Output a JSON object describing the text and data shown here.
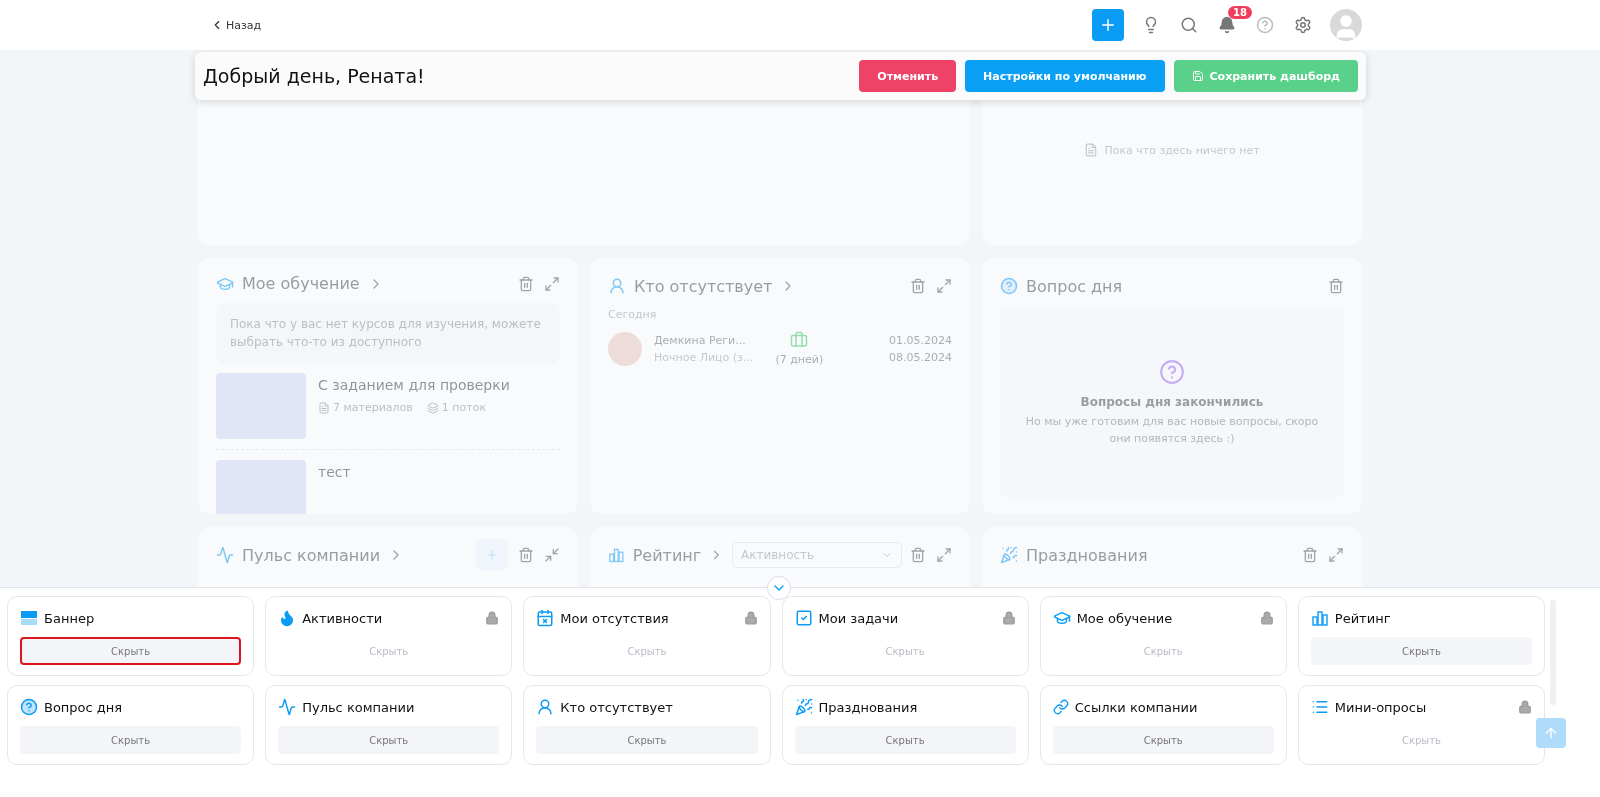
{
  "header": {
    "back": "Назад",
    "notifications": "18"
  },
  "edit_bar": {
    "greeting": "Добрый день, Рената!",
    "buttons": [
      {
        "label": "Отменить",
        "kind": "danger"
      },
      {
        "label": "Настройки по умолчанию",
        "kind": "primary"
      },
      {
        "label": "Сохранить дашборд",
        "kind": "success"
      }
    ]
  },
  "tasks": {
    "empty": "Пока что здесь ничего нет"
  },
  "learning": {
    "title": "Мое обучение",
    "notice": "Пока что у вас нет курсов для изучения, можете выбрать что-то из доступного",
    "courses": [
      {
        "title": "С заданием для проверки",
        "materials": "7 материалов",
        "streams": "1 поток"
      },
      {
        "title": "тест"
      }
    ]
  },
  "absent": {
    "title": "Кто отсутствует",
    "section": "Сегодня",
    "people": [
      {
        "name": "Демкина Реги...",
        "role": "Ночное Лицо (з...",
        "duration": "(7 дней)",
        "from": "01.05.2024",
        "to": "08.05.2024"
      }
    ]
  },
  "question": {
    "title": "Вопрос дня",
    "heading": "Вопросы дня закончились",
    "text": "Но мы уже готовим для вас новые вопросы, скоро они появятся здесь :)"
  },
  "pulse": {
    "title": "Пульс компании"
  },
  "rating": {
    "title": "Рейтинг",
    "filter": "Активность"
  },
  "celebrations": {
    "title": "Празднования"
  },
  "palette": [
    {
      "title": "Баннер",
      "kind": "banner",
      "locked": false,
      "selected": true,
      "action": "Скрыть"
    },
    {
      "title": "Активности",
      "kind": "fire",
      "locked": true,
      "selected": false,
      "action": "Скрыть"
    },
    {
      "title": "Мои отсутствия",
      "kind": "calendar",
      "locked": true,
      "selected": false,
      "action": "Скрыть"
    },
    {
      "title": "Мои задачи",
      "kind": "check",
      "locked": true,
      "selected": false,
      "action": "Скрыть"
    },
    {
      "title": "Мое обучение",
      "kind": "cap",
      "locked": true,
      "selected": false,
      "action": "Скрыть"
    },
    {
      "title": "Рейтинг",
      "kind": "chart",
      "locked": false,
      "selected": false,
      "action": "Скрыть"
    },
    {
      "title": "Вопрос дня",
      "kind": "question",
      "locked": false,
      "selected": false,
      "action": "Скрыть"
    },
    {
      "title": "Пульс компании",
      "kind": "pulse",
      "locked": false,
      "selected": false,
      "action": "Скрыть"
    },
    {
      "title": "Кто отсутствует",
      "kind": "user",
      "locked": false,
      "selected": false,
      "action": "Скрыть"
    },
    {
      "title": "Празднования",
      "kind": "party",
      "locked": false,
      "selected": false,
      "action": "Скрыть"
    },
    {
      "title": "Ссылки компании",
      "kind": "link",
      "locked": false,
      "selected": false,
      "action": "Скрыть"
    },
    {
      "title": "Мини-опросы",
      "kind": "list",
      "locked": true,
      "selected": false,
      "action": "Скрыть"
    }
  ]
}
